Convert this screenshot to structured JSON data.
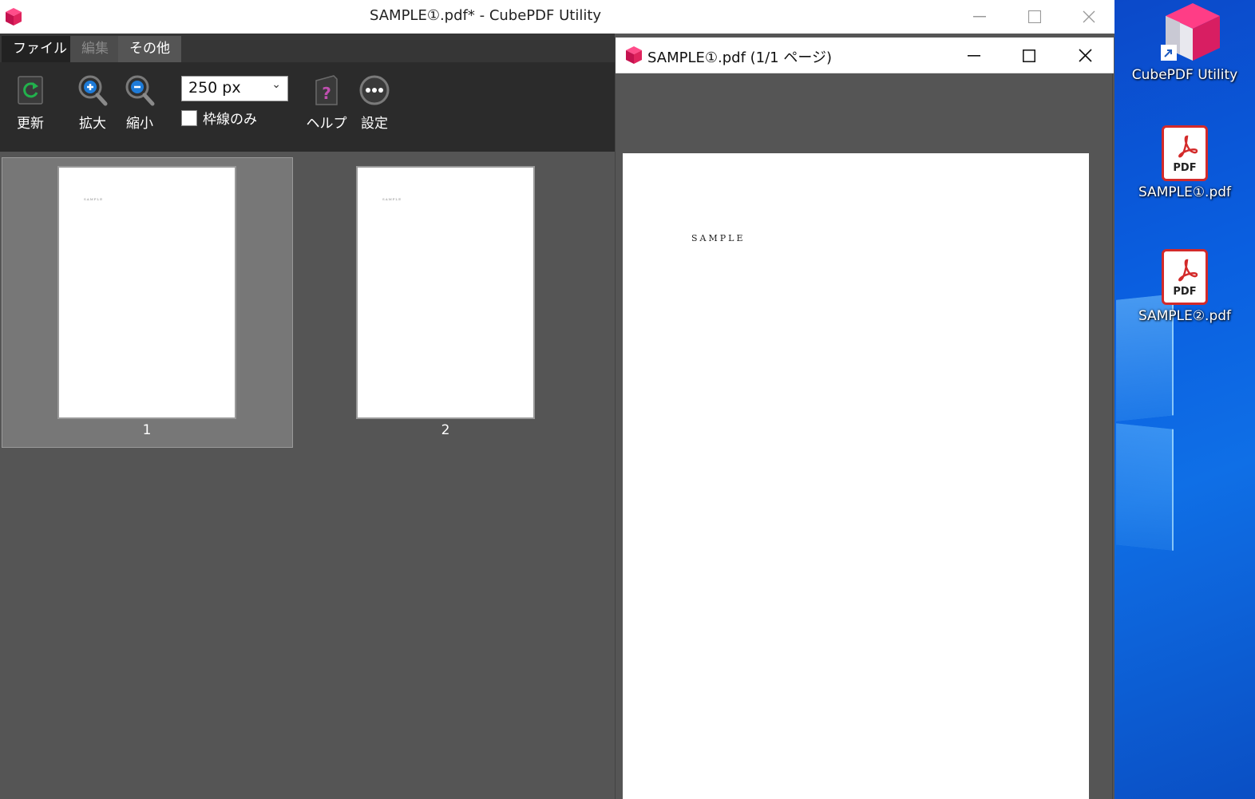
{
  "main_window": {
    "title": "SAMPLE①.pdf* - CubePDF Utility",
    "controls": {
      "minimize": "—",
      "maximize": "☐",
      "close": "✕"
    }
  },
  "menu": {
    "file": "ファイル",
    "edit": "編集",
    "other": "その他"
  },
  "ribbon": {
    "refresh": "更新",
    "zoom_in": "拡大",
    "zoom_out": "縮小",
    "zoom_value": "250 px",
    "frame_only": "枠線のみ",
    "help": "ヘルプ",
    "settings": "設定"
  },
  "pages": [
    {
      "number": "1",
      "text": "SAMPLE",
      "selected": true
    },
    {
      "number": "2",
      "text": "SAMPLE",
      "selected": false
    }
  ],
  "preview": {
    "title": "SAMPLE①.pdf (1/1 ページ)",
    "page_text": "SAMPLE"
  },
  "desktop": {
    "icons": [
      {
        "label": "CubePDF Utility",
        "type": "app-shortcut"
      },
      {
        "label": "SAMPLE①.pdf",
        "type": "pdf",
        "badge": "PDF"
      },
      {
        "label": "SAMPLE②.pdf",
        "type": "pdf",
        "badge": "PDF"
      }
    ]
  },
  "colors": {
    "accent_pink": "#e0245e",
    "pdf_red": "#d32a2a",
    "desktop_blue": "#0a5fe0"
  }
}
